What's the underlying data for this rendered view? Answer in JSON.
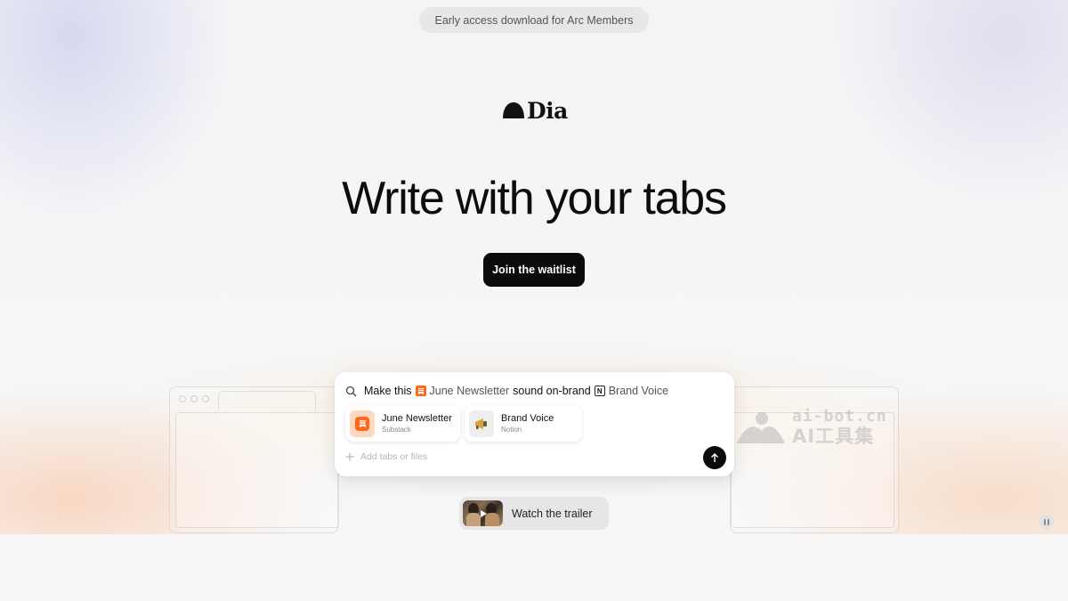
{
  "banner": {
    "label": "Early access download for Arc Members"
  },
  "brand": {
    "name": "Dia"
  },
  "hero": {
    "headline": "Write with your tabs",
    "cta_label": "Join the waitlist"
  },
  "prompt": {
    "prefix": "Make this",
    "ref1": "June Newsletter",
    "middle": "sound on-brand",
    "ref2": "Brand Voice",
    "add_placeholder": "Add tabs or files",
    "chips": [
      {
        "title": "June Newsletter",
        "subtitle": "Substack",
        "icon": "substack-icon",
        "color": "#ff6719"
      },
      {
        "title": "Brand Voice",
        "subtitle": "Notion",
        "icon": "megaphone-icon"
      }
    ]
  },
  "trailer": {
    "label": "Watch the trailer"
  },
  "watermark": {
    "line1": "ai-bot.cn",
    "line2": "AI工具集"
  }
}
